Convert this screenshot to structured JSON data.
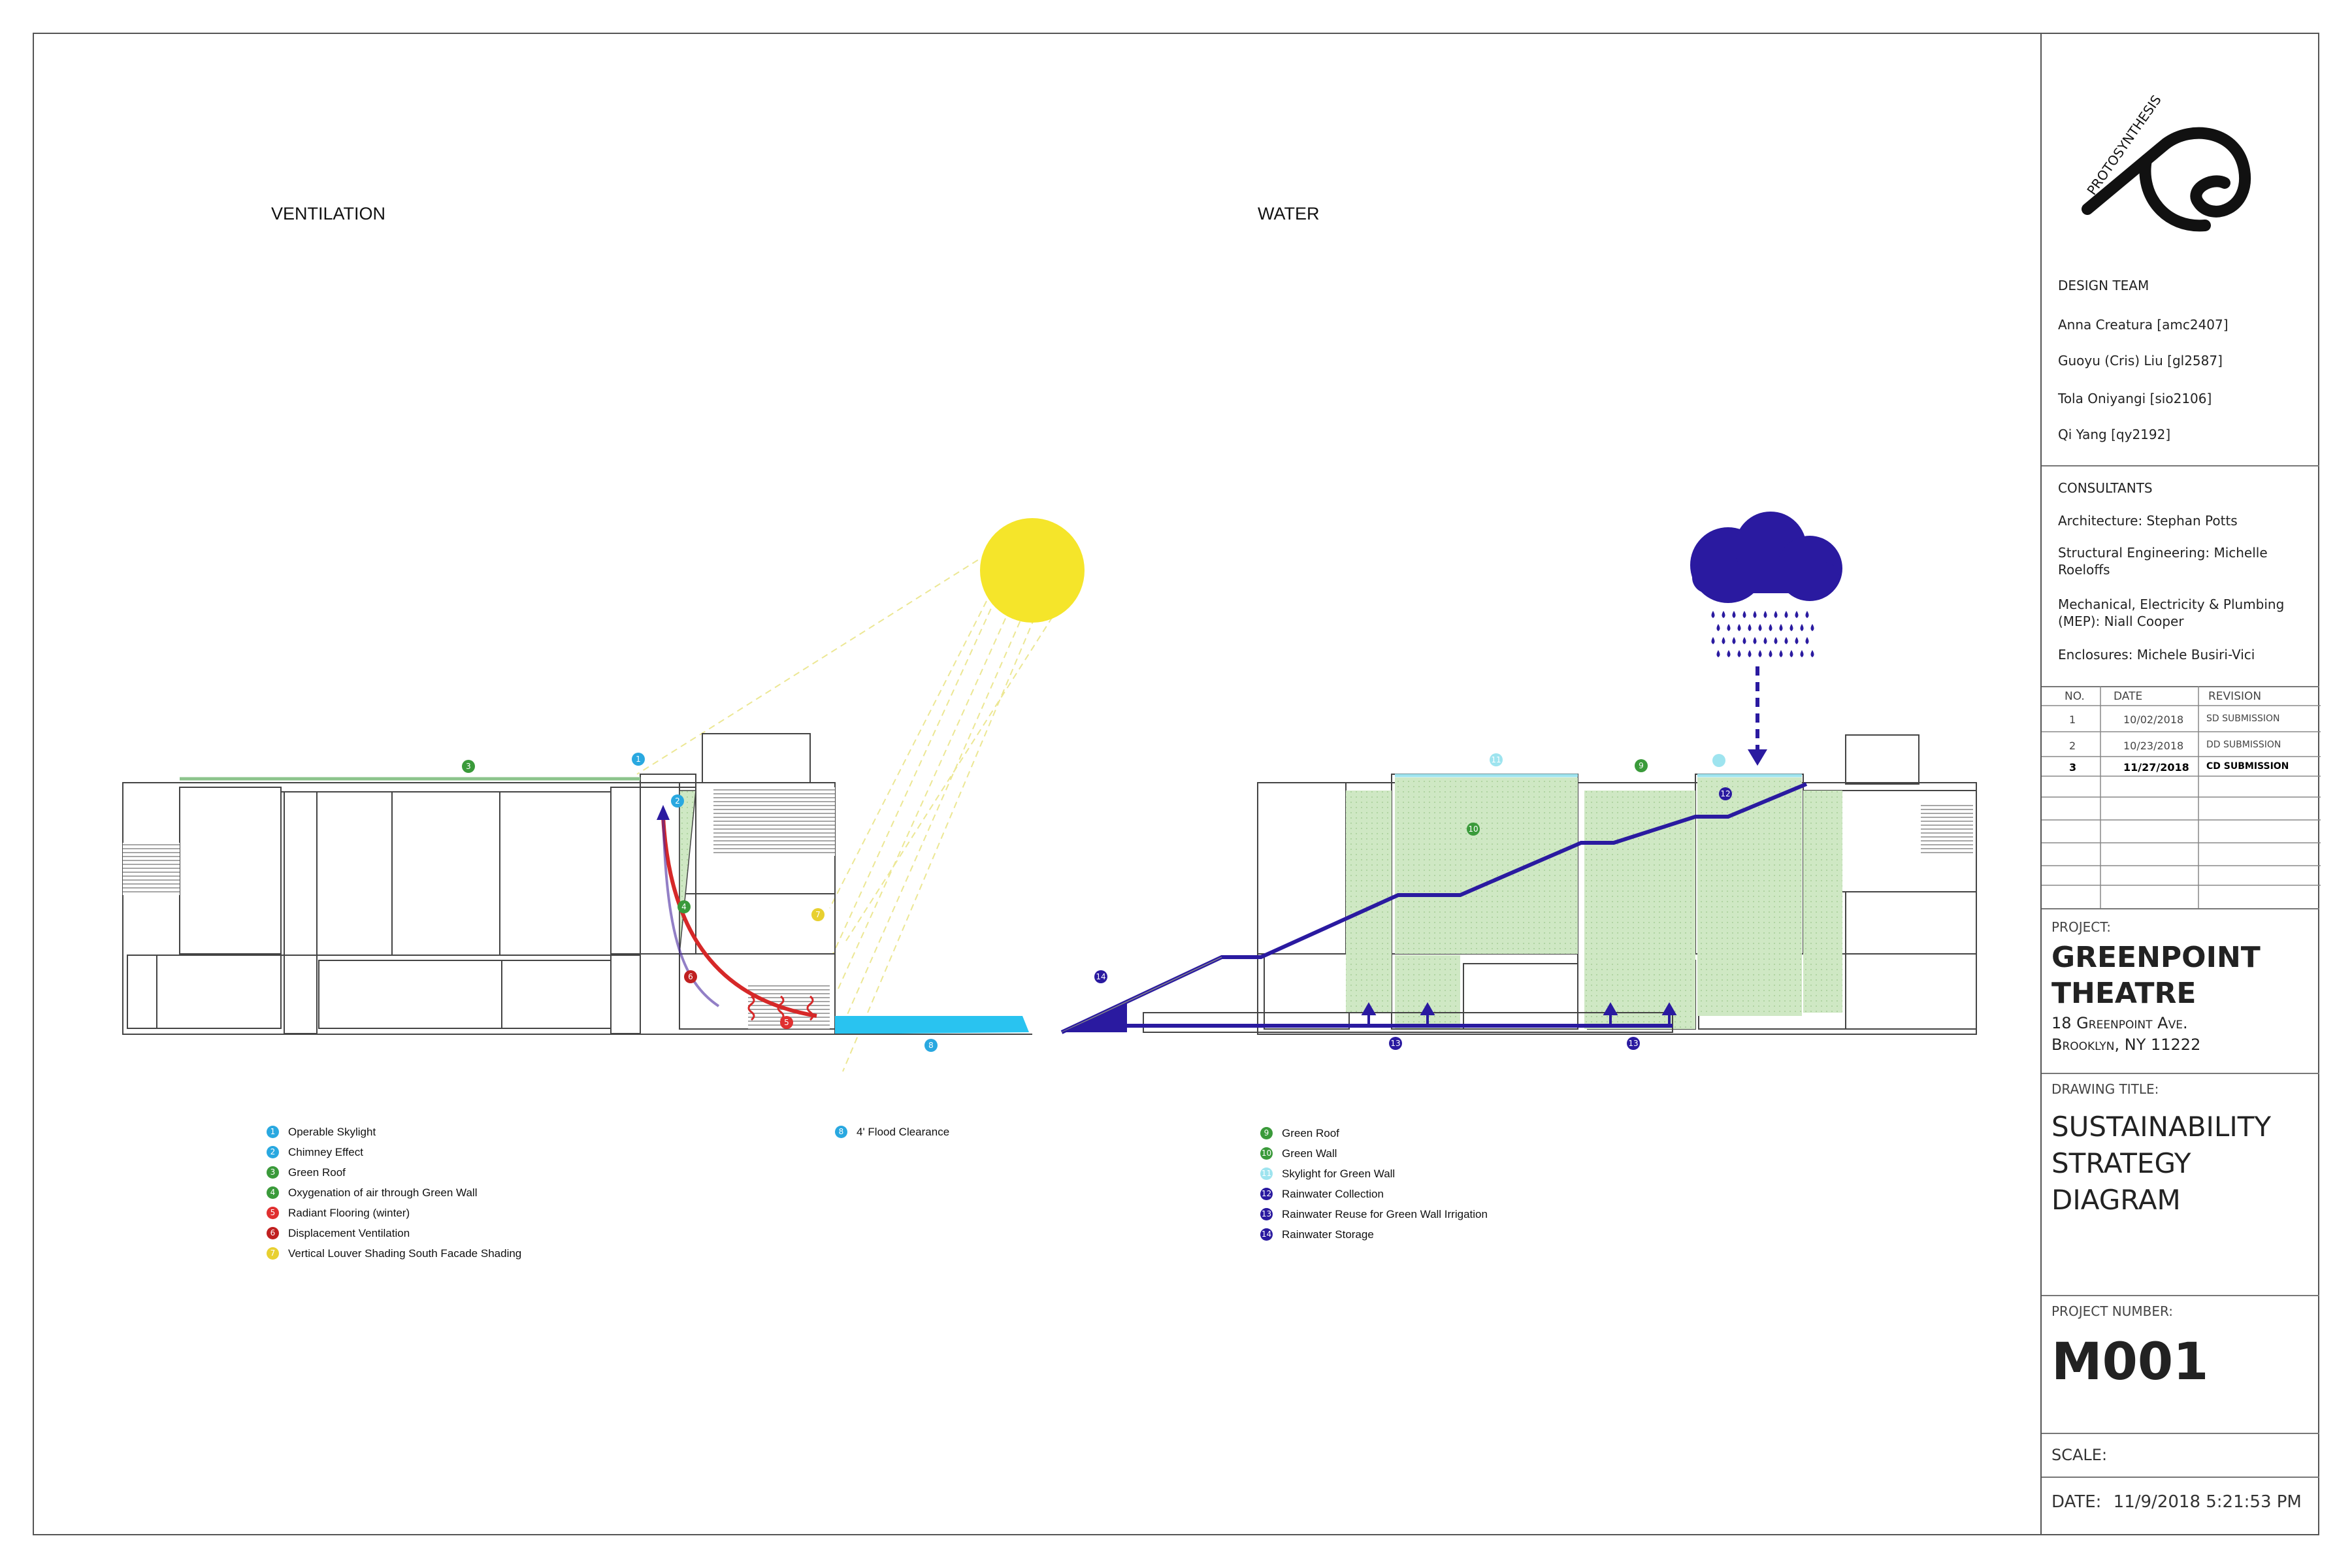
{
  "sections": {
    "ventilation": "VENTILATION",
    "water": "WATER"
  },
  "diagram_labels": {
    "n1": "1",
    "n2": "2",
    "n3": "3",
    "n4": "4",
    "n5": "5",
    "n6": "6",
    "n7": "7",
    "n8": "8",
    "n9": "9",
    "n10": "10",
    "n11": "11",
    "n12": "12",
    "n13a": "13",
    "n13b": "13",
    "n14": "14"
  },
  "legend_left": [
    {
      "num": "1",
      "label": "Operable Skylight",
      "color": "#29a8e0"
    },
    {
      "num": "2",
      "label": "Chimney Effect",
      "color": "#29a8e0"
    },
    {
      "num": "3",
      "label": "Green Roof",
      "color": "#3a9a3a"
    },
    {
      "num": "4",
      "label": "Oxygenation of air through Green Wall",
      "color": "#3a9a3a"
    },
    {
      "num": "5",
      "label": "Radiant Flooring (winter)",
      "color": "#e03030"
    },
    {
      "num": "6",
      "label": "Displacement Ventilation",
      "color": "#c02020"
    },
    {
      "num": "7",
      "label": "Vertical Louver Shading South Facade Shading",
      "color": "#e8d030"
    }
  ],
  "legend_mid": [
    {
      "num": "8",
      "label": "4' Flood Clearance",
      "color": "#29a8e0"
    }
  ],
  "legend_right": [
    {
      "num": "9",
      "label": "Green Roof",
      "color": "#3a9a3a"
    },
    {
      "num": "10",
      "label": "Green Wall",
      "color": "#3a9a3a"
    },
    {
      "num": "11",
      "label": "Skylight for Green Wall",
      "color": "#9ee4ef"
    },
    {
      "num": "12",
      "label": "Rainwater Collection",
      "color": "#2a1aa0"
    },
    {
      "num": "13",
      "label": "Rainwater Reuse for Green Wall Irrigation",
      "color": "#2a1aa0"
    },
    {
      "num": "14",
      "label": "Rainwater Storage",
      "color": "#2a1aa0"
    }
  ],
  "title_block": {
    "logo_text": "PROTOSYNTHESIS",
    "design_team_title": "DESIGN TEAM",
    "design_team": [
      "Anna Creatura [amc2407]",
      "Guoyu (Cris) Liu [gl2587]",
      "Tola Oniyangi [sio2106]",
      "Qi Yang [qy2192]"
    ],
    "consultants_title": "CONSULTANTS",
    "consultants": [
      "Architecture: Stephan Potts",
      "Structural Engineering: Michelle Roeloffs",
      "Mechanical, Electricity & Plumbing (MEP): Niall Cooper",
      "Enclosures: Michele Busiri-Vici"
    ],
    "revisions_header": {
      "no": "NO.",
      "date": "DATE",
      "revision": "REVISION"
    },
    "revisions": [
      {
        "no": "1",
        "date": "10/02/2018",
        "revision": "SD SUBMISSION"
      },
      {
        "no": "2",
        "date": "10/23/2018",
        "revision": "DD SUBMISSION"
      },
      {
        "no": "3",
        "date": "11/27/2018",
        "revision": "CD SUBMISSION"
      }
    ],
    "project_label": "PROJECT:",
    "project_name_1": "GREENPOINT",
    "project_name_2": "THEATRE",
    "address_1": "18 Greenpoint Ave.",
    "address_2": "Brooklyn, NY 11222",
    "drawing_title_label": "DRAWING TITLE:",
    "drawing_title_1": "SUSTAINABILITY",
    "drawing_title_2": "STRATEGY",
    "drawing_title_3": "DIAGRAM",
    "project_number_label": "PROJECT NUMBER:",
    "project_number": "M001",
    "scale_label": "SCALE:",
    "date_label": "DATE:",
    "date_value": "11/9/2018 5:21:53 PM"
  },
  "colors": {
    "skylight": "#29a8e0",
    "green": "#3a9a3a",
    "red": "#e03030",
    "sun": "#f5e52a",
    "water": "#29c3f0",
    "rain": "#2a1aa0",
    "greenwall": "#cfe8c4"
  }
}
